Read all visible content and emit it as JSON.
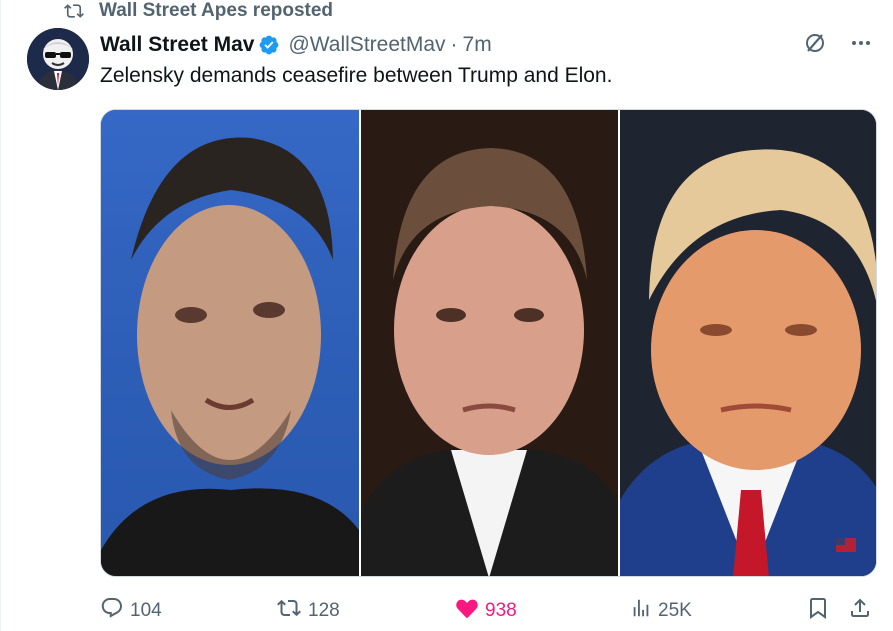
{
  "repost": {
    "label": "Wall Street Apes reposted"
  },
  "author": {
    "display_name": "Wall Street Mav",
    "handle": "@WallStreetMav",
    "separator": "·",
    "time": "7m"
  },
  "tweet": {
    "text": "Zelensky demands ceasefire between Trump and Elon.",
    "media_description_panels": [
      "left-portrait",
      "center-portrait",
      "right-portrait"
    ]
  },
  "actions": {
    "replies": "104",
    "reposts": "128",
    "likes": "938",
    "views": "25K"
  },
  "colors": {
    "text_primary": "#0f1419",
    "text_secondary": "#536471",
    "verified": "#1d9bf0",
    "like_active": "#f91880",
    "border": "#cfd9de"
  },
  "icons": {
    "repost": "repost-icon",
    "verified": "verified-badge-icon",
    "grok": "grok-icon",
    "more": "more-dots-icon",
    "reply": "reply-icon",
    "like": "heart-icon",
    "views": "views-chart-icon",
    "bookmark": "bookmark-icon",
    "share": "share-icon"
  }
}
